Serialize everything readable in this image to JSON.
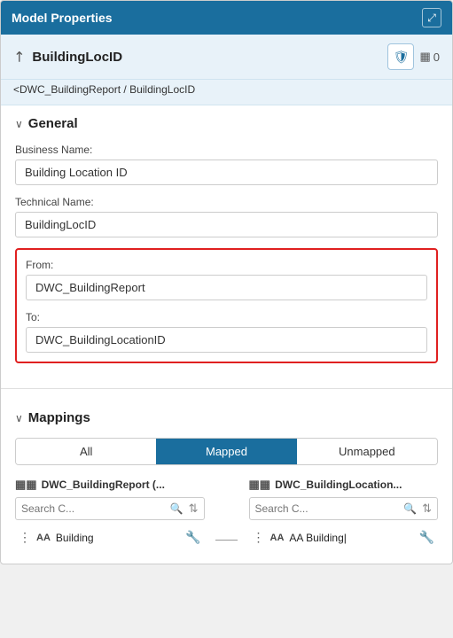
{
  "header": {
    "title": "Model Properties",
    "expand_icon": "⤢"
  },
  "entity": {
    "name": "BuildingLocID",
    "icon": "↗",
    "shield_icon": "🛡",
    "count": "0",
    "grid_icon": "▦"
  },
  "breadcrumb": {
    "parent_link": "<DWC_BuildingReport",
    "separator": " / ",
    "current": "BuildingLocID"
  },
  "general": {
    "title": "General",
    "business_name_label": "Business Name:",
    "business_name_value": "Building Location ID",
    "technical_name_label": "Technical Name:",
    "technical_name_value": "BuildingLocID",
    "from_label": "From:",
    "from_value": "DWC_BuildingReport",
    "to_label": "To:",
    "to_value": "DWC_BuildingLocationID"
  },
  "mappings": {
    "title": "Mappings",
    "tabs": [
      {
        "label": "All",
        "active": false
      },
      {
        "label": "Mapped",
        "active": true
      },
      {
        "label": "Unmapped",
        "active": false
      }
    ],
    "left_col": {
      "icon": "▦▦",
      "title": "DWC_BuildingReport (...",
      "search_placeholder": "Search C...",
      "item_icon": "▦▦",
      "item_label": "AA Building",
      "item_aa": "AA"
    },
    "right_col": {
      "icon": "▦▦",
      "title": "DWC_BuildingLocation...",
      "search_placeholder": "Search C...",
      "item_icon": "▦▦",
      "item_label": "AA Building|",
      "item_aa": "AA"
    }
  }
}
